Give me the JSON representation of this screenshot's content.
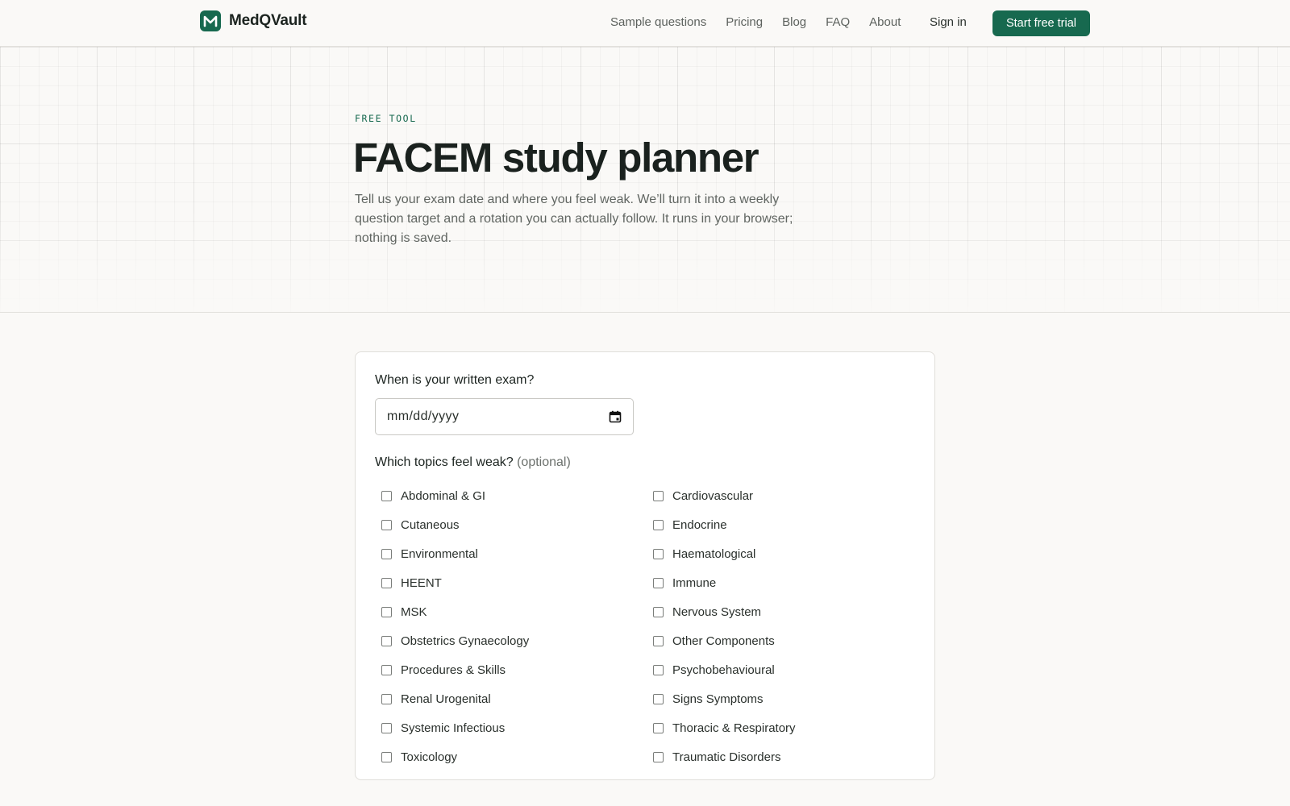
{
  "brand": {
    "name": "MedQVault",
    "logo_icon": "m-logo-icon",
    "accent": "#17694f"
  },
  "nav": {
    "items": [
      {
        "label": "Sample questions"
      },
      {
        "label": "Pricing"
      },
      {
        "label": "Blog"
      },
      {
        "label": "FAQ"
      },
      {
        "label": "About"
      }
    ],
    "signin_label": "Sign in",
    "cta_label": "Start free trial"
  },
  "hero": {
    "eyebrow": "FREE TOOL",
    "title": "FACEM study planner",
    "subtitle": "Tell us your exam date and where you feel weak. We’ll turn it into a weekly question target and a rotation you can actually follow. It runs in your browser; nothing is saved."
  },
  "form": {
    "exam_label": "When is your written exam?",
    "exam_placeholder": "mm/dd/yyyy",
    "calendar_icon": "calendar-icon",
    "topics_label": "Which topics feel weak?",
    "topics_optional": "(optional)",
    "topics": [
      {
        "label": "Abdominal & GI",
        "checked": false
      },
      {
        "label": "Cardiovascular",
        "checked": false
      },
      {
        "label": "Cutaneous",
        "checked": false
      },
      {
        "label": "Endocrine",
        "checked": false
      },
      {
        "label": "Environmental",
        "checked": false
      },
      {
        "label": "Haematological",
        "checked": false
      },
      {
        "label": "HEENT",
        "checked": false
      },
      {
        "label": "Immune",
        "checked": false
      },
      {
        "label": "MSK",
        "checked": false
      },
      {
        "label": "Nervous System",
        "checked": false
      },
      {
        "label": "Obstetrics Gynaecology",
        "checked": false
      },
      {
        "label": "Other Components",
        "checked": false
      },
      {
        "label": "Procedures & Skills",
        "checked": false
      },
      {
        "label": "Psychobehavioural",
        "checked": false
      },
      {
        "label": "Renal Urogenital",
        "checked": false
      },
      {
        "label": "Signs Symptoms",
        "checked": false
      },
      {
        "label": "Systemic Infectious",
        "checked": false
      },
      {
        "label": "Thoracic & Respiratory",
        "checked": false
      },
      {
        "label": "Toxicology",
        "checked": false
      },
      {
        "label": "Traumatic Disorders",
        "checked": false
      }
    ]
  }
}
